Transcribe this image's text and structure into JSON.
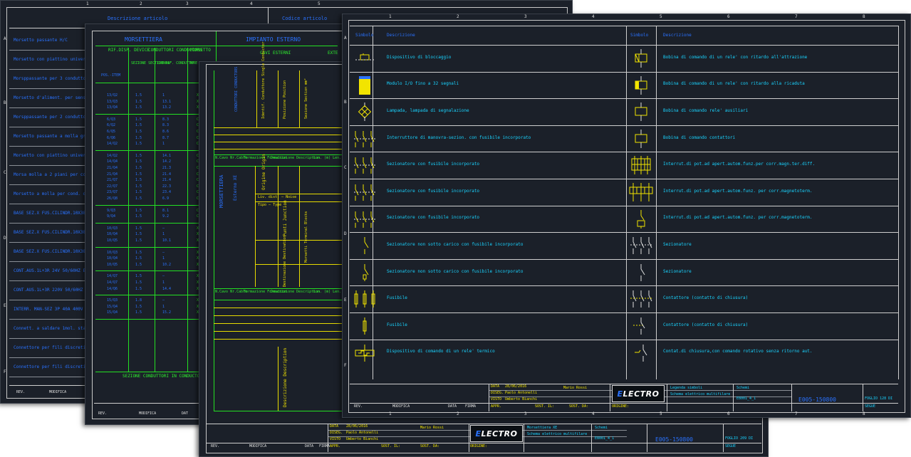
{
  "sheet1": {
    "header_left": "Descrizione articolo",
    "header_right": "Codice articolo",
    "rows": [
      "Morsetto passante H/C",
      "Morsetto con piattino universale g",
      "Morsppassante per 3 conduttori g",
      "Morsetto d'aliment. per sensori",
      "Morsppassante per 2 conduttori g",
      "Morsetto passante a molla grigio",
      "Morsetto con piattino universale g",
      "Morsa molla a 2 piani per cond.",
      "Morsetto a molla per cond. di ta",
      "BASE SEZ.X FUS.CILINDR.10X38 1P",
      "BASE SEZ.X FUS.CILINDR.10X38 3",
      "BASE SEZ.X FUS.CILINDR.10X38 3P",
      "CONT.AUS.1L+3R 24V 50/60HZ E",
      "CONT.AUS.1L+3R 220V 50/60HZ",
      "INTERR. MAN-SEZ 3P 40A 400V",
      "Connett. a saldare 1mol. stagno c",
      "Connettore per fili discreti IDC m",
      "Connettore per fili discreti IDC m"
    ],
    "footer": [
      "REV.",
      "MODIFICA"
    ]
  },
  "sheet2": {
    "header": [
      "MORSETTIERA",
      "IMPIANTO ESTERNO",
      "EXT"
    ],
    "col_titles": [
      "RIF.DISP. DEVICE",
      "CONDUTTORI CONDUCTORS",
      "MORSETTO"
    ],
    "sub_headers": [
      "SEZIONE SECTION mm²",
      "IDENTIF. CONDUTTORE SINGLE CONDUCTOR",
      "N°",
      "CAVI ESTERNI",
      "EXTE"
    ],
    "pos_label": "POS.-ITEM",
    "rows": [
      [
        "13/Q2",
        "1.5",
        "1",
        "X"
      ],
      [
        "13/Q3",
        "1.5",
        "13.1",
        "X"
      ],
      [
        "13/Q4",
        "1.5",
        "13.2",
        "X"
      ],
      [
        "6/Q3",
        "1.5",
        "8.3",
        "C"
      ],
      [
        "6/Q2",
        "1.5",
        "8.3",
        "C"
      ],
      [
        "6/Q5",
        "1.5",
        "8.6",
        "C"
      ],
      [
        "6/Q6",
        "1.5",
        "8.7",
        "C"
      ],
      [
        "14/Q2",
        "1.5",
        "1",
        "C"
      ],
      [
        "14/Q2",
        "1.5",
        "14.1",
        "C"
      ],
      [
        "14/Q4",
        "1.5",
        "14.2",
        "CI"
      ],
      [
        "21/Q4",
        "1.5",
        "21.3",
        "CI"
      ],
      [
        "21/Q4",
        "1.5",
        "21.4",
        "CI"
      ],
      [
        "21/Q7",
        "1.5",
        "21.4",
        "CI"
      ],
      [
        "22/Q7",
        "1.5",
        "22.3",
        "CI"
      ],
      [
        "23/Q7",
        "1.5",
        "23.4",
        "CI"
      ],
      [
        "26/Q8",
        "1.5",
        "6.9",
        "C"
      ],
      [
        "9/Q3",
        "1.5",
        "8.1",
        "C"
      ],
      [
        "9/Q4",
        "1.5",
        "9.2",
        "C"
      ],
      [
        "10/Q3",
        "1.5",
        "–",
        "X"
      ],
      [
        "10/Q4",
        "1.5",
        "1",
        "X"
      ],
      [
        "10/Q5",
        "1.5",
        "10.1",
        "X"
      ],
      [
        "10/Q3",
        "1.5",
        "–",
        "X"
      ],
      [
        "10/Q4",
        "1.5",
        "1",
        "X"
      ],
      [
        "10/Q5",
        "1.5",
        "10.2",
        "X"
      ],
      [
        "14/Q7",
        "1.5",
        "–",
        "X"
      ],
      [
        "14/Q7",
        "1.5",
        "1",
        "X"
      ],
      [
        "14/Q6",
        "1.5",
        "14.4",
        "X"
      ],
      [
        "15/Q3",
        "1.8",
        "–",
        "XS"
      ],
      [
        "15/Q4",
        "1.5",
        "1",
        "XS"
      ],
      [
        "15/Q4",
        "1.5",
        "15.2",
        "XS"
      ]
    ],
    "footer_note": "SEZIONE CONDUTTORI IN CONDUCTORS SECTION ARE IN",
    "footer": [
      "REV.",
      "MODIFICA",
      "DAT"
    ]
  },
  "sheet3": {
    "vertical_labels": [
      "CONDUTTORI CONDUCTORS",
      "Identif. Conduttore Single Conductor",
      "Posizione Position",
      "Sezione Section mm²",
      "MORSETTIERA",
      "Esterno XE",
      "Origine Origin",
      "Punti Junction",
      "Morsetti Terminal Blocks",
      "Destinazione Destination",
      "Descrizione Description"
    ],
    "cable_header": [
      "N.Cavo Nr.Cable",
      "Formazione Formation",
      "Descrizione Description",
      "Lun. (m) Len. (m)"
    ],
    "liv_label": "Liv. dist. – Noise",
    "tipo_label": "Tipo – Type",
    "title": {
      "data_label": "DATA",
      "data": "28/06/2016",
      "diseg_label": "DISEG.",
      "diseg": "Paolo Antonelli",
      "visto_label": "VISTO",
      "visto": "Umberto Bianchi",
      "appr": "APPR.",
      "sost_li": "SOST. IL:",
      "sost_da": "SOST. DA:",
      "origine": "ORIGINE:",
      "author": "Mario Rossi",
      "desc1": "Morsettiera XE",
      "desc2": "Schema elettrico multifilare",
      "schemi": "Schemi",
      "code": "E8001_4_1",
      "big_code": "E005-150800",
      "foglio": "FOGLIO 209 DI",
      "segue": "SEGUE",
      "footer": [
        "REV.",
        "MODIFICA",
        "DATA",
        "FIRMA"
      ]
    }
  },
  "sheet4": {
    "ruler_top": [
      "1",
      "2",
      "3",
      "4",
      "5",
      "6",
      "7",
      "8"
    ],
    "ruler_side": [
      "A",
      "B",
      "C",
      "D",
      "E",
      "F"
    ],
    "header": [
      "Simbolo",
      "Descrizione",
      "Simbolo",
      "Descrizione"
    ],
    "rows": [
      {
        "left": "Dispositivo di bloccaggio",
        "right": "Bobina di comando di un rele' con ritardo all'attrazione"
      },
      {
        "left": "Modulo I/O fino a 32 segnali",
        "right": "Bobina di comando di un rele' con ritardo alla ricaduta"
      },
      {
        "left": "Lampada, lampada di segnalazione",
        "right": "Bobina di comando rele' ausiliari"
      },
      {
        "left": "Interruttore di manovra-sezion. con fusibile incorporato",
        "right": "Bobina di comando contattori"
      },
      {
        "left": "Sezionatore con fusibile incorporato",
        "right": "Interrut.di pot.ad apert.autom.funz.per corr.magn.ter.diff."
      },
      {
        "left": "Sezionatore con fusibile incorporato",
        "right": "Interrut.di pot.ad apert.autom.funz. per corr.magnetoterm."
      },
      {
        "left": "Sezionatore con fusibile incorporato",
        "right": "Interrut.di pot.ad apert.autom.funz. per corr.magnetoterm."
      },
      {
        "left": "Sezionatore non sotto carico con fusibile incorporato",
        "right": "Sezionatore"
      },
      {
        "left": "Sezionatore non sotto carico con fusibile incorporato",
        "right": "Sezionatore"
      },
      {
        "left": "Fusibile",
        "right": "Contattore (contatto di chiusura)"
      },
      {
        "left": "Fusibile",
        "right": "Contattore (contatto di chiusura)"
      },
      {
        "left": "Dispositivo di comando di un rele' termico",
        "right": "Contat.di chiusura,con comando rotativo senza ritorno aut."
      }
    ],
    "title": {
      "data_label": "DATA",
      "data": "28/06/2016",
      "diseg_label": "DISEG.",
      "diseg": "Paolo Antonelli",
      "visto_label": "VISTO",
      "visto": "Umberto Bianchi",
      "appr": "APPR.",
      "sost_li": "SOST. IL:",
      "sost_da": "SOST. DA:",
      "origine": "ORIGINE:",
      "author": "Mario Rossi",
      "desc1": "Legenda simboli",
      "desc2": "Schema elettrico multifilare",
      "schemi": "Schemi",
      "code": "E8001_4_1",
      "big_code": "E005-150800",
      "foglio": "FOGLIO 128 DI",
      "segue": "SEGUE",
      "footer": [
        "REV.",
        "MODIFICA",
        "DATA",
        "FIRMA"
      ]
    }
  },
  "logo": {
    "pre": "E",
    "main": "LECTRO"
  },
  "colors": {
    "sheet_bg": "#1b2029",
    "cyan": "#19d3ff",
    "green": "#2ef02e",
    "yellow": "#f2e400",
    "blue": "#2a72ff",
    "frame": "#cfcfcf"
  }
}
